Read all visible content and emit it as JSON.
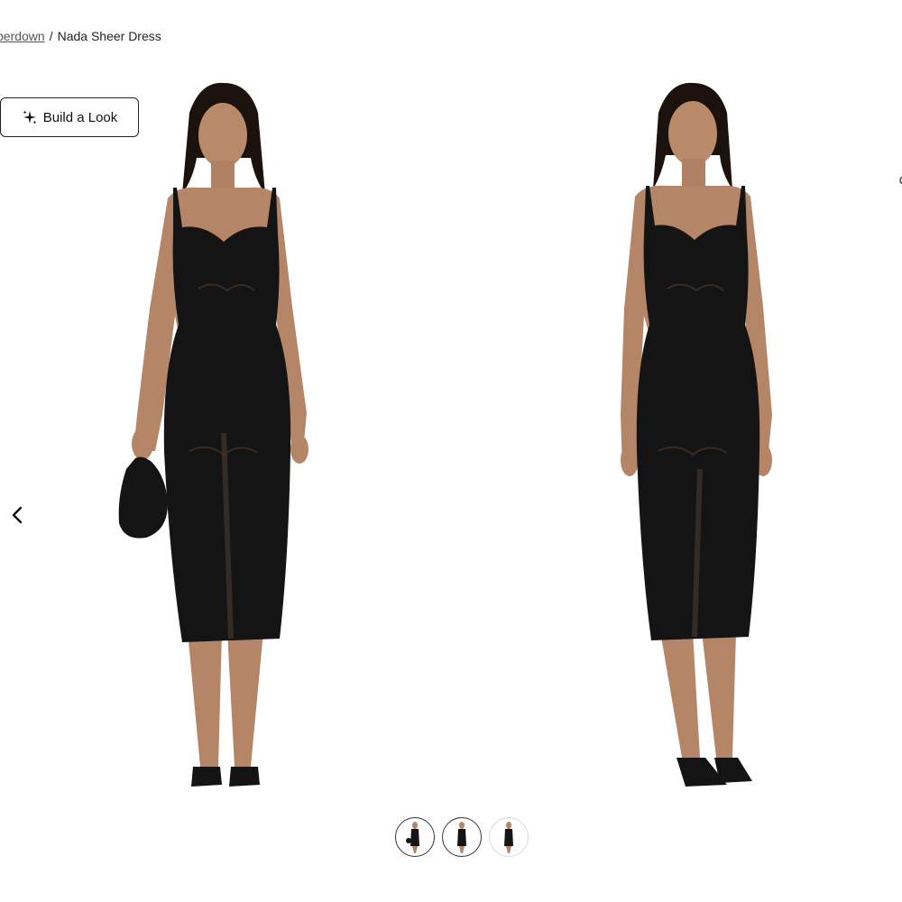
{
  "breadcrumb": {
    "parent_label": "perdown",
    "separator": "/",
    "current_label": "Nada Sheer Dress"
  },
  "build_look": {
    "label": "Build a Look",
    "icon": "sparkle-icon"
  },
  "gallery": {
    "images": [
      {
        "name": "model-front-with-bag",
        "alt": "Nada Sheer Dress front view"
      },
      {
        "name": "model-front",
        "alt": "Nada Sheer Dress alternate front view"
      }
    ],
    "prev_icon": "chevron-left-icon",
    "thumbnails": [
      {
        "name": "thumbnail-1",
        "selected": false
      },
      {
        "name": "thumbnail-2",
        "selected": false
      },
      {
        "name": "thumbnail-3",
        "selected": false
      }
    ]
  },
  "colors": {
    "text": "#222222",
    "border": "#222222",
    "dress": "#141414",
    "skin": "#b98a6a"
  }
}
